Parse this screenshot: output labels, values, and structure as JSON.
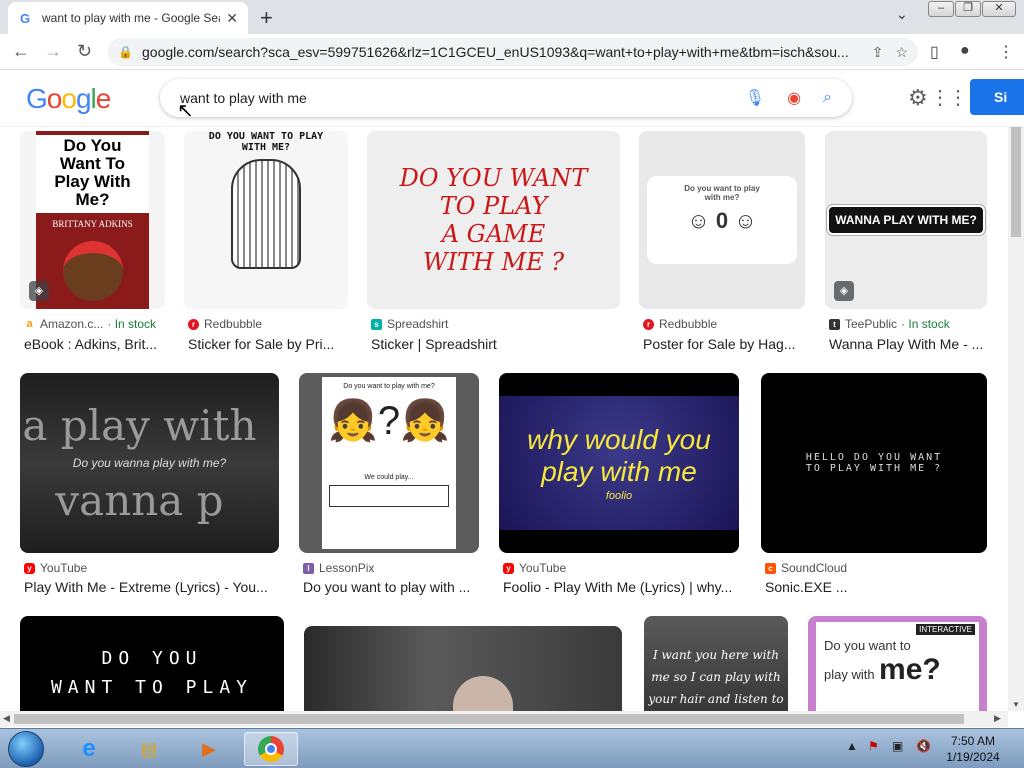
{
  "browser": {
    "tab_title": "want to play with me - Google Search",
    "tab_favicon": "G",
    "url": "google.com/search?sca_esv=599751626&rlz=1C1GCEU_enUS1093&q=want+to+play+with+me&tbm=isch&sou..."
  },
  "header": {
    "logo": "Google",
    "search_query": "want to play with me",
    "signin_label": "Si"
  },
  "results": [
    {
      "source": "Amazon.c...",
      "stock": "In stock",
      "caption": "eBook : Adkins, Brit...",
      "thumb_lines": [
        "Do You",
        "Want To",
        "Play With",
        "Me?",
        "BRITTANY ADKINS"
      ],
      "source_color": "#ff9900",
      "source_icon": "a"
    },
    {
      "source": "Redbubble",
      "stock": "",
      "caption": "Sticker for Sale by Pri...",
      "thumb_lines": [
        "DO YOU WANT TO PLAY",
        "WITH ME?"
      ],
      "source_color": "#e41321",
      "source_icon": "r"
    },
    {
      "source": "Spreadshirt",
      "stock": "",
      "caption": "Sticker | Spreadshirt",
      "thumb_lines": [
        "DO YOU WANT",
        "TO PLAY",
        "A GAME",
        "WITH ME ?"
      ],
      "source_color": "#00b2a5",
      "source_icon": "s"
    },
    {
      "source": "Redbubble",
      "stock": "",
      "caption": "Poster for Sale by Hag...",
      "thumb_lines": [
        "Do you want to play",
        "with me?"
      ],
      "source_color": "#e41321",
      "source_icon": "r"
    },
    {
      "source": "TeePublic",
      "stock": "In stock",
      "caption": "Wanna Play With Me - ...",
      "thumb_lines": [
        "WANNA PLAY WITH ME?"
      ],
      "source_color": "#333333",
      "source_icon": "t"
    },
    {
      "source": "YouTube",
      "stock": "",
      "caption": "Play With Me - Extreme (Lyrics) - You...",
      "thumb_lines": [
        "a play with",
        "Do you wanna play with me?",
        "vanna p"
      ],
      "source_color": "#ff0000",
      "source_icon": "y"
    },
    {
      "source": "LessonPix",
      "stock": "",
      "caption": "Do you want to play with ...",
      "thumb_lines": [
        "Do you want to play with me?",
        "We could play..."
      ],
      "source_color": "#7b5ea7",
      "source_icon": "l"
    },
    {
      "source": "YouTube",
      "stock": "",
      "caption": "Foolio - Play With Me (Lyrics) | why...",
      "thumb_lines": [
        "why would you",
        "play with me",
        "foolio"
      ],
      "source_color": "#ff0000",
      "source_icon": "y"
    },
    {
      "source": "SoundCloud",
      "stock": "",
      "caption": "Sonic.EXE ...",
      "thumb_lines": [
        "HELLO DO YOU WANT",
        "TO PLAY WITH ME ?"
      ],
      "source_color": "#ff5500",
      "source_icon": "c"
    },
    {
      "source": "",
      "stock": "",
      "caption": "",
      "thumb_lines": [
        "DO YOU",
        "WANT TO PLAY"
      ],
      "source_color": "#000000",
      "source_icon": ""
    },
    {
      "source": "",
      "stock": "",
      "caption": "",
      "thumb_lines": [],
      "source_color": "#000000",
      "source_icon": ""
    },
    {
      "source": "",
      "stock": "",
      "caption": "",
      "thumb_lines": [
        "I want you here with",
        "me so I can play with",
        "your hair and listen to"
      ],
      "source_color": "#000000",
      "source_icon": ""
    },
    {
      "source": "",
      "stock": "",
      "caption": "",
      "thumb_lines": [
        "INTERACTIVE",
        "Do you want to",
        "play with",
        "me?"
      ],
      "source_color": "#000000",
      "source_icon": ""
    }
  ],
  "taskbar": {
    "time": "7:50 AM",
    "date": "1/19/2024"
  }
}
